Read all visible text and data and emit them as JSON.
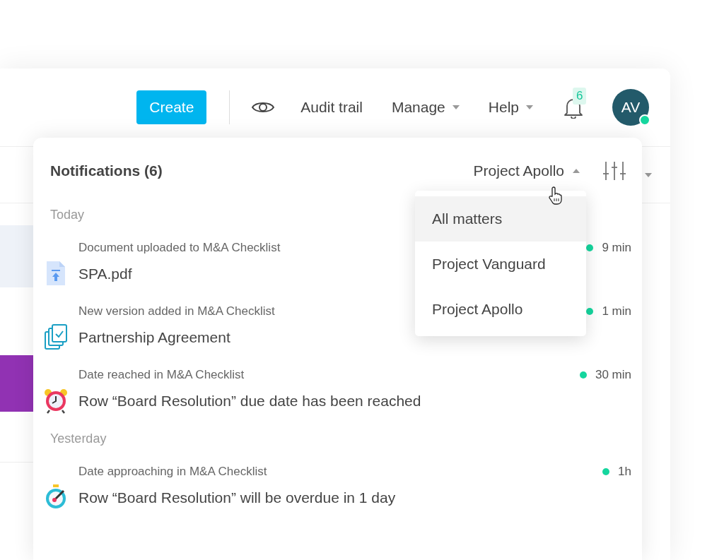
{
  "header": {
    "create_button": "Create",
    "nav_links": [
      {
        "label": "Audit trail",
        "dropdown": false
      },
      {
        "label": "Manage",
        "dropdown": true
      },
      {
        "label": "Help",
        "dropdown": true
      }
    ],
    "notification_count": "6",
    "avatar": {
      "initials": "AV",
      "online": true
    }
  },
  "notifications": {
    "title": "Notifications (6)",
    "matter_filter": {
      "label": "Project Apollo",
      "expanded": true,
      "options": [
        {
          "label": "All matters",
          "highlighted": true
        },
        {
          "label": "Project Vanguard",
          "highlighted": false
        },
        {
          "label": "Project Apollo",
          "highlighted": false
        }
      ]
    },
    "groups": [
      {
        "label": "Today",
        "items": [
          {
            "kind": "upload",
            "subtitle": "Document uploaded to M&A Checklist",
            "title": "SPA.pdf",
            "time": "9 min",
            "unread": true
          },
          {
            "kind": "version",
            "subtitle": "New version added in M&A Checklist",
            "title": "Partnership Agreement",
            "time": "1 min",
            "unread": true
          },
          {
            "kind": "alarm",
            "subtitle": "Date reached in M&A Checklist",
            "title": "Row “Board Resolution” due date has been reached",
            "time": "30 min",
            "unread": true
          }
        ]
      },
      {
        "label": "Yesterday",
        "items": [
          {
            "kind": "stopwatch",
            "subtitle": "Date approaching in M&A Checklist",
            "title": "Row “Board Resolution” will be overdue in 1 day",
            "time": "1h",
            "unread": true
          }
        ]
      }
    ]
  }
}
